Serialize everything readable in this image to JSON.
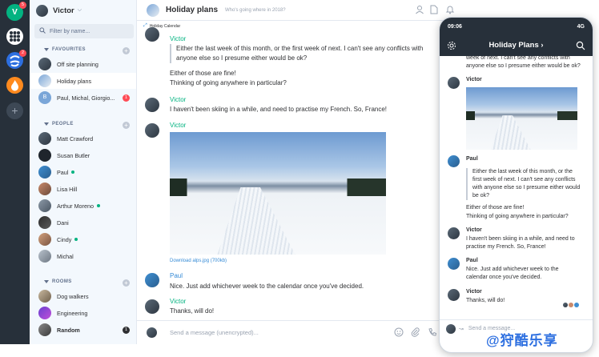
{
  "spacebar": {
    "items": [
      {
        "letter": "V",
        "color": "#03b381",
        "badge": "5"
      },
      {
        "letter": "",
        "color": "#ffffff",
        "badge": ""
      },
      {
        "letter": "",
        "color": "#2d6fe0",
        "badge": "2"
      },
      {
        "letter": "",
        "color": "#ff8a1e",
        "badge": ""
      }
    ],
    "add_icon": "plus-icon"
  },
  "user": {
    "name": "Victor"
  },
  "search": {
    "placeholder": "Filter by name..."
  },
  "sections": {
    "favourites": "FAVOURITES",
    "people": "PEOPLE",
    "rooms": "ROOMS"
  },
  "favourites": [
    {
      "name": "Off site planning"
    },
    {
      "name": "Holiday plans"
    },
    {
      "name": "Paul, Michal, Giorgio...",
      "initial": "B",
      "count": "1"
    }
  ],
  "people": [
    {
      "name": "Matt Crawford"
    },
    {
      "name": "Susan Butler"
    },
    {
      "name": "Paul"
    },
    {
      "name": "Lisa Hill"
    },
    {
      "name": "Arthur Moreno"
    },
    {
      "name": "Dani"
    },
    {
      "name": "Cindy"
    },
    {
      "name": "Michal"
    }
  ],
  "rooms": [
    {
      "name": "Dog walkers"
    },
    {
      "name": "Engineering"
    },
    {
      "name": "Random",
      "count": "1"
    }
  ],
  "room": {
    "title": "Holiday plans",
    "topic": "Who's going where in 2018?"
  },
  "timeline": {
    "widget_label": "Holiday Calendar",
    "m1_sender": "Victor",
    "m1_quote": "Either the last week of this month, or the first week of next. I can't see any conflicts with anyone else so I presume either would be ok?",
    "m1_line1": "Either of those are fine!",
    "m1_line2": "Thinking of going anywhere in particular?",
    "m2_sender": "Victor",
    "m2_text": "I haven't been skiing in a while, and need to practise my French. So, France!",
    "m3_sender": "Victor",
    "m3_download": "Download alps.jpg (700kb)",
    "m4_sender": "Paul",
    "m4_text": "Nice. Just add whichever week to the calendar once you've decided.",
    "m5_sender": "Victor",
    "m5_text": "Thanks, will do!"
  },
  "composer": {
    "placeholder": "Send a message (unencrypted)..."
  },
  "phone": {
    "time": "09:06",
    "network": "4G",
    "title": "Holiday Plans",
    "top_text": "week of next. I can't see any conflicts with anyone else so I presume either would be ok?",
    "s1": "Victor",
    "s2": "Paul",
    "quote": "Either the last week of this month, or the first week of next. I can't see any conflicts with anyone else so I presume either would be ok?",
    "l1": "Either of those are fine!",
    "l2": "Thinking of going anywhere in particular?",
    "s3": "Victor",
    "m3": "I haven't been skiing in a while, and need to practise my French. So, France!",
    "s4": "Paul",
    "m4": "Nice. Just add whichever week to the calendar once you've decided.",
    "s5": "Victor",
    "m5": "Thanks, will do!",
    "composer": "Send a message..."
  },
  "watermark": "@狩酷乐享"
}
